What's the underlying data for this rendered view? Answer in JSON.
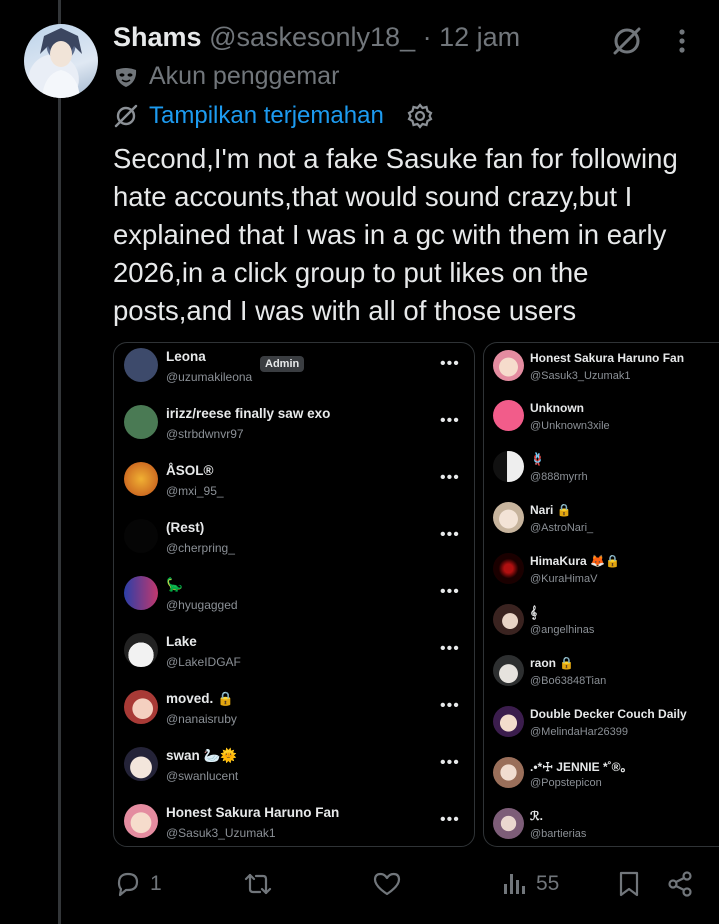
{
  "post": {
    "author_name": "Shams",
    "author_handle": "@saskesonly18_",
    "separator": "·",
    "time": "12 jam",
    "fan_label": "Akun penggemar",
    "translate_label": "Tampilkan terjemahan",
    "text": "Second,I'm not a fake Sasuke fan for following hate accounts,that would sound crazy,but I explained that I was in a gc with them in early 2026,in a click group to put likes on the posts,and I was with all of those users"
  },
  "left_list": [
    {
      "name": "Leona",
      "handle": "@uzumakileona",
      "badge": "Admin",
      "av": "#3d4a6b"
    },
    {
      "name": "irizz/reese finally saw exo",
      "handle": "@strbdwnvr97",
      "av": "#4a7a54"
    },
    {
      "name": "ÅSOL®",
      "handle": "@mxi_95_",
      "av": "#d1741f"
    },
    {
      "name": "(Rest)",
      "handle": "@cherpring_",
      "av": "#050505"
    },
    {
      "name": "🦕",
      "handle": "@hyugagged",
      "av": "#2b3fa8"
    },
    {
      "name": "Lake",
      "handle": "@LakeIDGAF",
      "av": "#e9e9e9"
    },
    {
      "name": "moved. 🔒",
      "handle": "@nanaisruby",
      "av": "#b84a46"
    },
    {
      "name": "swan 🦢🌞",
      "handle": "@swanlucent",
      "av": "#e2dbe4"
    },
    {
      "name": "Honest Sakura Haruno Fan",
      "handle": "@Sasuk3_Uzumak1",
      "av": "#e8b6a0"
    }
  ],
  "right_list": [
    {
      "name": "Honest Sakura Haruno Fan",
      "handle": "@Sasuk3_Uzumak1",
      "av": "#e8b6a0"
    },
    {
      "name": "Unknown",
      "handle": "@Unknown3xile",
      "av": "#f25c8a"
    },
    {
      "name": "🪢",
      "handle": "@888myrrh",
      "av": "#d9d9d9"
    },
    {
      "name": "Nari 🔒",
      "handle": "@AstroNari_",
      "av": "#e6d6c4"
    },
    {
      "name": "HimaKura 🦊🔒",
      "handle": "@KuraHimaV",
      "av": "#3a0000"
    },
    {
      "name": "𝄞",
      "handle": "@angelhinas",
      "av": "#5b3a35"
    },
    {
      "name": "raon 🔒",
      "handle": "@Bo63848Tian",
      "av": "#6f7a72"
    },
    {
      "name": "Double Decker Couch Daily",
      "handle": "@MelindaHar26399",
      "av": "#4a2c5a"
    },
    {
      "name": ".•*☩ JENNIE *˚®。",
      "handle": "@Popstepicon",
      "av": "#c9a89a"
    },
    {
      "name": "ℛ.",
      "handle": "@bartierias",
      "av": "#a58aa0"
    }
  ],
  "actions": {
    "replies": "1",
    "reposts": "",
    "likes": "",
    "views": "55"
  },
  "icons": [
    "grok-icon",
    "more-icon",
    "mask-icon",
    "translate-icon",
    "gear-icon",
    "reply-icon",
    "repost-icon",
    "like-icon",
    "views-icon",
    "bookmark-icon",
    "share-icon"
  ],
  "colors": {
    "link": "#1d9bf0",
    "muted": "#71767b",
    "text": "#e7e9ea",
    "bg": "#000000"
  }
}
